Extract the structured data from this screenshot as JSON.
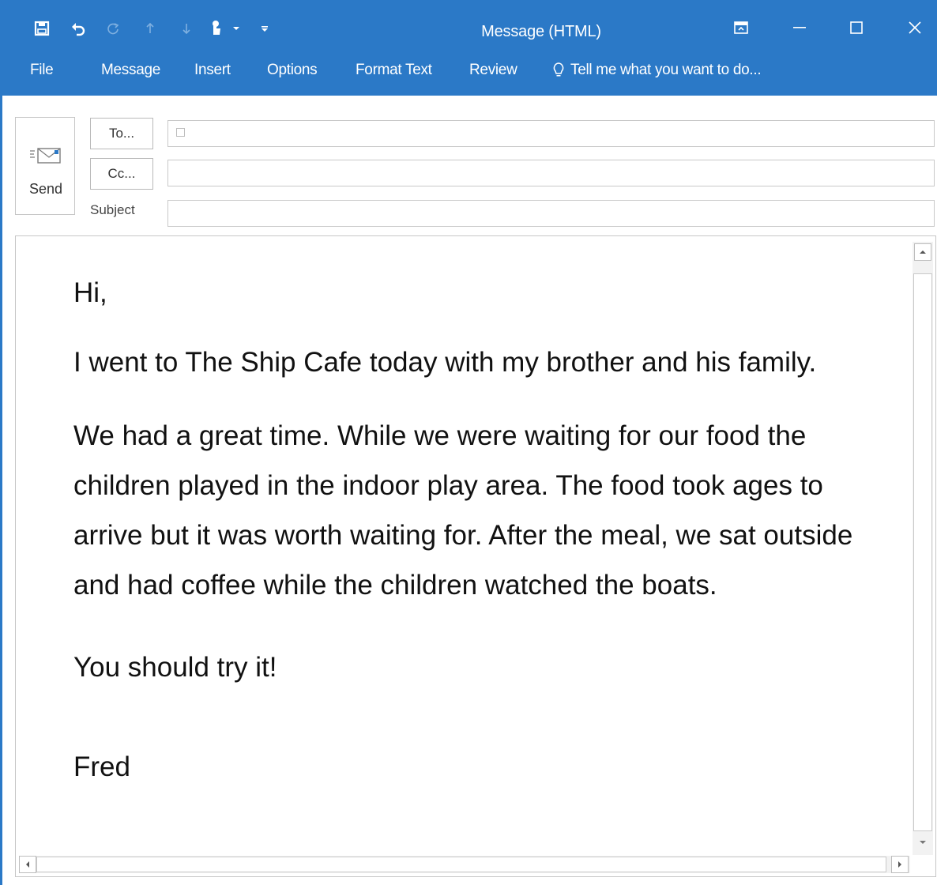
{
  "window": {
    "title": "Message (HTML)"
  },
  "quick_access": {
    "icons": [
      "save-icon",
      "undo-icon",
      "redo-icon",
      "up-arrow-icon",
      "down-arrow-icon",
      "touch-mode-icon",
      "customize-dropdown-icon"
    ]
  },
  "menu": {
    "file": "File",
    "message": "Message",
    "insert": "Insert",
    "options": "Options",
    "format_text": "Format Text",
    "review": "Review",
    "tell_me": "Tell me what you want to do..."
  },
  "header": {
    "send_label": "Send",
    "to_label": "To...",
    "cc_label": "Cc...",
    "subject_label": "Subject",
    "to_value": "",
    "cc_value": "",
    "subject_value": ""
  },
  "message": {
    "greeting": "Hi,",
    "line1": "I went to The Ship Cafe today with my brother and his family.",
    "paragraph2": "We had a great time. While we were waiting for our food the children played in the indoor play area. The food took ages to arrive but it was worth waiting for. After the meal, we sat outside and had coffee while the children watched the boats.",
    "closing": "You should try it!",
    "signature": "Fred"
  },
  "colors": {
    "ribbon": "#2b79c7",
    "text": "#111111"
  }
}
